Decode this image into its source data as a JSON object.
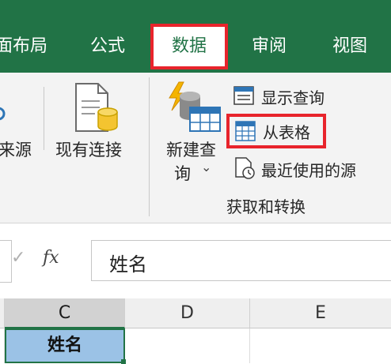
{
  "tabs": {
    "page_layout": "面布局",
    "formulas": "公式",
    "data": "数据",
    "review": "审阅",
    "view": "视图"
  },
  "ribbon": {
    "source_partial": "来源",
    "existing_connections": "现有连接",
    "new_query_line1": "新建查",
    "new_query_line2": "询",
    "new_query_arrow": "⌄",
    "show_queries": "显示查询",
    "from_table": "从表格",
    "recent_sources": "最近使用的源",
    "group_label": "获取和转换"
  },
  "formula_bar": {
    "check_glyph": "✓",
    "fx_label": "fx",
    "value": "姓名"
  },
  "grid": {
    "columns": [
      "C",
      "D",
      "E"
    ],
    "selected_cell_value": "姓名"
  },
  "colors": {
    "accent": "#217346",
    "highlight": "#e8242c",
    "selection_fill": "#9bc2e6"
  }
}
